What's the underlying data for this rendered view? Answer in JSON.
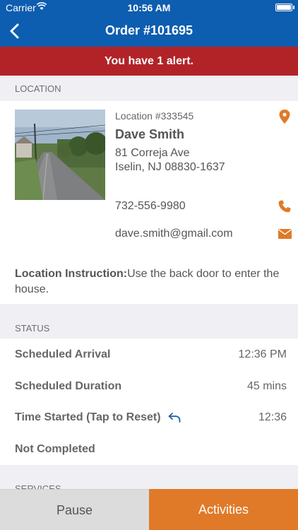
{
  "status_bar": {
    "carrier": "Carrier",
    "time": "10:56 AM"
  },
  "nav": {
    "title": "Order #101695"
  },
  "alert": {
    "text": "You have 1 alert."
  },
  "location": {
    "header": "LOCATION",
    "location_number": "Location #333545",
    "name": "Dave Smith",
    "address_line1": "81 Correja Ave",
    "address_line2": "Iselin, NJ 08830-1637",
    "phone": "732-556-9980",
    "email": "dave.smith@gmail.com",
    "instruction_label": "Location Instruction:",
    "instruction_text": "Use the back door to enter the house."
  },
  "status": {
    "header": "STATUS",
    "rows": [
      {
        "label": "Scheduled Arrival",
        "value": "12:36 PM"
      },
      {
        "label": "Scheduled Duration",
        "value": "45 mins"
      },
      {
        "label": "Time Started (Tap to Reset)",
        "value": "12:36"
      },
      {
        "label": "Not Completed",
        "value": ""
      }
    ]
  },
  "services": {
    "header": "SERVICES"
  },
  "footer": {
    "pause_label": "Pause",
    "activities_label": "Activities"
  },
  "colors": {
    "nav_blue": "#0d5db0",
    "alert_red": "#b22328",
    "accent_orange": "#e07a28"
  },
  "icons": [
    "back-chevron-icon",
    "wifi-icon",
    "battery-icon",
    "location-pin-icon",
    "phone-icon",
    "mail-icon",
    "reset-icon"
  ]
}
